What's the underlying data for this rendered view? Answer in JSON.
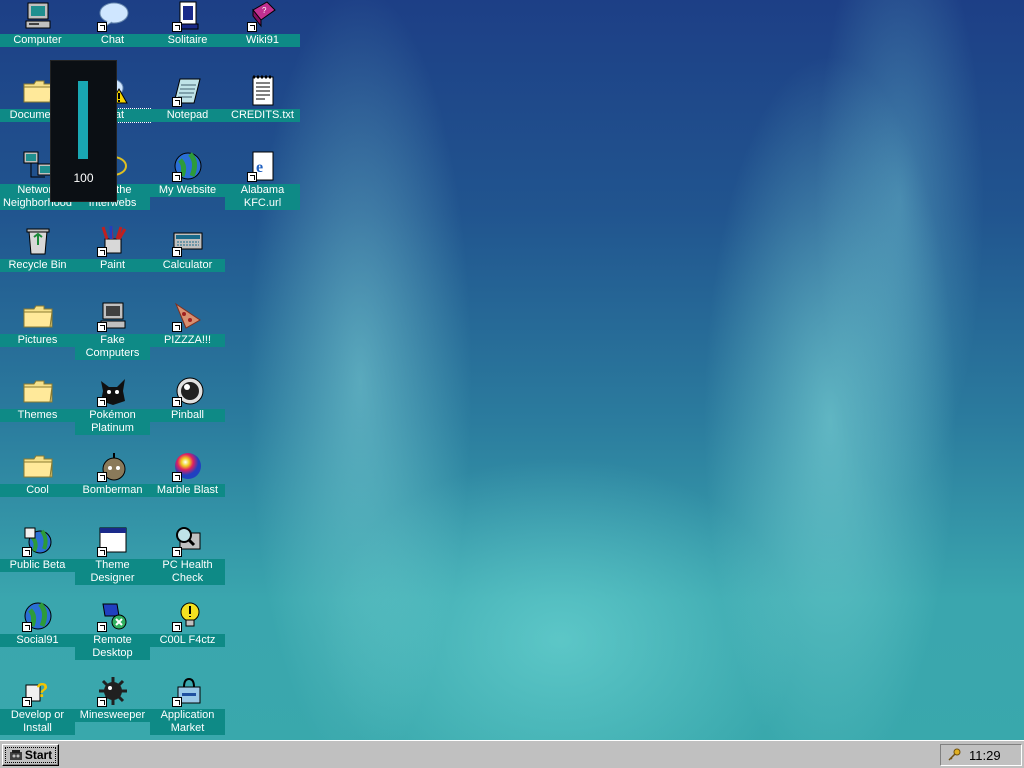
{
  "desktop": {
    "icons": [
      {
        "label": "Computer",
        "icon": "computer-icon"
      },
      {
        "label": "Chat",
        "icon": "chat-bubble-icon"
      },
      {
        "label": "Solitaire",
        "icon": "solitaire-icon"
      },
      {
        "label": "Wiki91",
        "icon": "wiki-book-icon"
      },
      {
        "label": "Documents",
        "icon": "folder-icon"
      },
      {
        "label": "Chat",
        "icon": "chat-warning-icon"
      },
      {
        "label": "Notepad",
        "icon": "notepad-icon"
      },
      {
        "label": "CREDITS.txt",
        "icon": "text-file-icon"
      },
      {
        "label": "Network Neighborhood",
        "icon": "network-icon"
      },
      {
        "label": "Use the Interwebs",
        "icon": "browser-icon"
      },
      {
        "label": "My Website",
        "icon": "globe-icon"
      },
      {
        "label": "Alabama KFC.url",
        "icon": "url-file-icon"
      },
      {
        "label": "Recycle Bin",
        "icon": "recycle-bin-icon"
      },
      {
        "label": "Paint",
        "icon": "paint-icon"
      },
      {
        "label": "Calculator",
        "icon": "calculator-icon"
      },
      {
        "label": "Pictures",
        "icon": "folder-icon"
      },
      {
        "label": "Fake Computers",
        "icon": "computer-icon"
      },
      {
        "label": "PIZZZA!!!",
        "icon": "pizza-icon"
      },
      {
        "label": "Themes",
        "icon": "folder-icon"
      },
      {
        "label": "Pokémon Platinum",
        "icon": "pokemon-icon"
      },
      {
        "label": "Pinball",
        "icon": "pinball-icon"
      },
      {
        "label": "Cool",
        "icon": "folder-icon"
      },
      {
        "label": "Bomberman",
        "icon": "bomberman-icon"
      },
      {
        "label": "Marble Blast",
        "icon": "marble-icon"
      },
      {
        "label": "Public Beta",
        "icon": "public-beta-icon"
      },
      {
        "label": "Theme Designer",
        "icon": "window-icon"
      },
      {
        "label": "PC Health Check",
        "icon": "health-check-icon"
      },
      {
        "label": "Social91",
        "icon": "globe-icon"
      },
      {
        "label": "Remote Desktop",
        "icon": "remote-desktop-icon"
      },
      {
        "label": "C00L F4ctz",
        "icon": "lightbulb-icon"
      },
      {
        "label": "Develop or Install",
        "icon": "help-icon"
      },
      {
        "label": "Minesweeper",
        "icon": "mine-icon"
      },
      {
        "label": "Application Market",
        "icon": "market-bag-icon"
      }
    ]
  },
  "volume": {
    "value": "100",
    "level": 1.0
  },
  "taskbar": {
    "start_label": "Start",
    "clock": "11:29"
  },
  "colors": {
    "label_bg": "#0e8a86",
    "taskbar": "#c0c0c0",
    "volume_fill": "#19a7b3"
  }
}
